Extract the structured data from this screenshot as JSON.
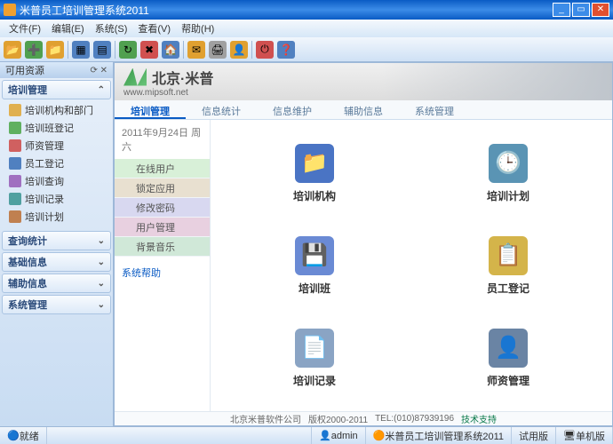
{
  "window": {
    "title": "米普员工培训管理系统2011"
  },
  "menu": {
    "file": "文件(F)",
    "edit": "编辑(E)",
    "system": "系统(S)",
    "view": "查看(V)",
    "help": "帮助(H)"
  },
  "sidebar": {
    "header": "可用资源",
    "sections": [
      {
        "title": "培训管理",
        "items": [
          {
            "label": "培训机构和部门",
            "color": "#e0b050"
          },
          {
            "label": "培训班登记",
            "color": "#60b060"
          },
          {
            "label": "师资管理",
            "color": "#d06060"
          },
          {
            "label": "员工登记",
            "color": "#5080c0"
          },
          {
            "label": "培训查询",
            "color": "#a070c0"
          },
          {
            "label": "培训记录",
            "color": "#50a0a0"
          },
          {
            "label": "培训计划",
            "color": "#c08050"
          }
        ]
      },
      {
        "title": "查询统计"
      },
      {
        "title": "基础信息"
      },
      {
        "title": "辅助信息"
      },
      {
        "title": "系统管理"
      }
    ]
  },
  "banner": {
    "brand": "北京·米普",
    "url": "www.mipsoft.net"
  },
  "tabs": [
    {
      "label": "培训管理",
      "active": true
    },
    {
      "label": "信息统计"
    },
    {
      "label": "信息维护"
    },
    {
      "label": "辅助信息"
    },
    {
      "label": "系统管理"
    }
  ],
  "date": "2011年9月24日 周六",
  "leftmenu": [
    "在线用户",
    "锁定应用",
    "修改密码",
    "用户管理",
    "背景音乐"
  ],
  "help_link": "系统帮助",
  "grid": [
    {
      "label": "培训机构",
      "color": "#4a74c4",
      "icon": "📁"
    },
    {
      "label": "培训计划",
      "color": "#5a94b4",
      "icon": "🕒"
    },
    {
      "label": "培训班",
      "color": "#6a8ad4",
      "icon": "💾"
    },
    {
      "label": "员工登记",
      "color": "#d4b44a",
      "icon": "📋"
    },
    {
      "label": "培训记录",
      "color": "#8aa4c4",
      "icon": "📄"
    },
    {
      "label": "师资管理",
      "color": "#6a84a4",
      "icon": "👤"
    }
  ],
  "footer": {
    "company": "北京米普软件公司",
    "copyright": "版权2000-2011",
    "tel": "TEL:(010)87939196",
    "support": "技术支持"
  },
  "status": {
    "ready": "就绪",
    "user": "admin",
    "app": "米普员工培训管理系统2011",
    "trial": "试用版",
    "mode": "单机版"
  },
  "toolbar_icons": [
    {
      "c": "#e0a030",
      "g": "📂"
    },
    {
      "c": "#50a050",
      "g": "➕"
    },
    {
      "c": "#e0a030",
      "g": "📁"
    },
    {
      "c": "#5080c0",
      "g": "▦"
    },
    {
      "c": "#5080c0",
      "g": "▤"
    },
    {
      "c": "#50a050",
      "g": "↻"
    },
    {
      "c": "#d05050",
      "g": "✖"
    },
    {
      "c": "#5080c0",
      "g": "🏠"
    },
    {
      "c": "#e0a030",
      "g": "✉"
    },
    {
      "c": "#a0a0a0",
      "g": "🖨"
    },
    {
      "c": "#e0a030",
      "g": "👤"
    },
    {
      "c": "#d05050",
      "g": "⏻"
    },
    {
      "c": "#5080c0",
      "g": "❓"
    }
  ]
}
